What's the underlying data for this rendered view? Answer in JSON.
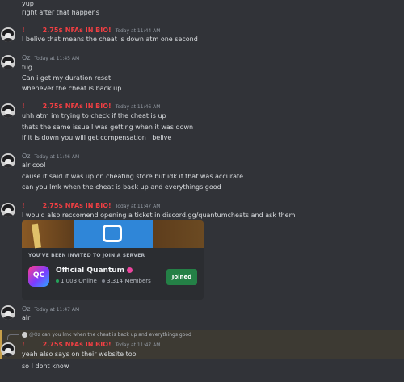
{
  "messages": {
    "m0": {
      "lines": [
        "yup",
        "right after that happens"
      ]
    },
    "m1": {
      "excl": "!",
      "username": "2.75$ NFAs IN BIO!",
      "time": "Today at 11:44 AM",
      "lines": [
        "I belive that means the cheat is down atm one second"
      ]
    },
    "m2": {
      "username": "Oz",
      "time": "Today at 11:45 AM",
      "lines": [
        "fug",
        "Can i get my duration reset",
        "whenever the cheat is back up"
      ]
    },
    "m3": {
      "excl": "!",
      "username": "2.75$ NFAs IN BIO!",
      "time": "Today at 11:46 AM",
      "lines": [
        "uhh atm im trying to check if the cheat is up",
        "thats the same issue I was getting when it was down",
        "if it is down you will get compensation I belive"
      ]
    },
    "m4": {
      "username": "Oz",
      "time": "Today at 11:46 AM",
      "lines": [
        "alr cool",
        "cause it said it was up on cheating.store but idk if that was accurate",
        "can you lmk when the cheat is back up and everythings good"
      ]
    },
    "m5": {
      "excl": "!",
      "username": "2.75$ NFAs IN BIO!",
      "time": "Today at 11:47 AM",
      "lines": [
        "I would also reccomend opening a ticket in discord.gg/quantumcheats and ask them"
      ]
    },
    "m6": {
      "username": "Oz",
      "time": "Today at 11:47 AM",
      "lines": [
        "alr"
      ]
    },
    "m7": {
      "excl": "!",
      "username": "2.75$ NFAs IN BIO!",
      "time": "Today at 11:47 AM",
      "lines": [
        "yeah also says on their website too",
        "so I dont know"
      ]
    }
  },
  "reply": {
    "name": "@Oz",
    "text": "can you lmk when the cheat is back up and everythings good"
  },
  "invite": {
    "title": "YOU'VE BEEN INVITED TO JOIN A SERVER",
    "icon_text": "QC",
    "server_name": "Official Quantum",
    "online": "1,003 Online",
    "members": "3,314 Members",
    "button": "Joined"
  },
  "colors": {
    "background": "#313338",
    "username_red": "#f23f43",
    "joined_button": "#248046",
    "online_dot": "#23a55a",
    "members_dot": "#80848e",
    "highlight": "#3d3a33"
  }
}
